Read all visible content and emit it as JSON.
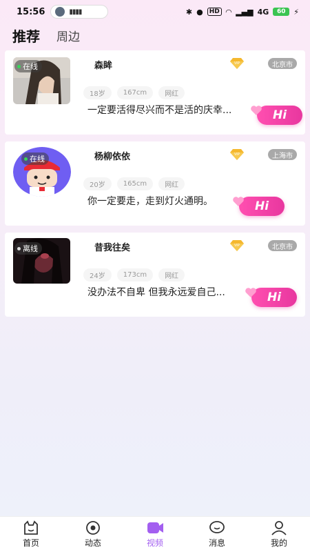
{
  "status_bar": {
    "time": "15:56",
    "battery": "60",
    "hd": "HD",
    "network": "4G"
  },
  "tabs": [
    {
      "label": "推荐",
      "active": true
    },
    {
      "label": "周边",
      "active": false
    }
  ],
  "users": [
    {
      "name": "森眸",
      "status": "在线",
      "online": true,
      "city": "北京市",
      "age": "18岁",
      "height": "167cm",
      "tag": "网红",
      "signature": "一定要活得尽兴而不是活的庆幸...",
      "hi": "Hi",
      "avatar": "photo-woman-hair"
    },
    {
      "name": "杨柳依依",
      "status": "在线",
      "online": true,
      "city": "上海市",
      "age": "20岁",
      "height": "165cm",
      "tag": "网红",
      "signature": "你一定要走，走到灯火通明。",
      "hi": "Hi",
      "avatar": "cartoon-boy"
    },
    {
      "name": "昔我往矣",
      "status": "离线",
      "online": false,
      "city": "北京市",
      "age": "24岁",
      "height": "173cm",
      "tag": "网红",
      "signature": "没办法不自卑 但我永远爱自己...",
      "hi": "Hi",
      "avatar": "photo-dark-woman"
    }
  ],
  "bottom_nav": [
    {
      "label": "首页",
      "icon": "home-cat-icon",
      "active": false
    },
    {
      "label": "动态",
      "icon": "eye-icon",
      "active": false
    },
    {
      "label": "视频",
      "icon": "video-camera-icon",
      "active": true
    },
    {
      "label": "消息",
      "icon": "chat-bubble-icon",
      "active": false
    },
    {
      "label": "我的",
      "icon": "person-icon",
      "active": false
    }
  ],
  "colors": {
    "accent": "#a35ff0",
    "hi_gradient_start": "#ff4fb0",
    "hi_gradient_end": "#e8379f",
    "online_dot": "#39d55a",
    "vip_gold": "#f5b82e"
  }
}
